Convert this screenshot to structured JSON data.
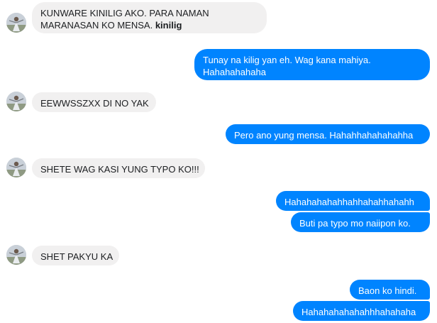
{
  "conversation": {
    "messages": [
      {
        "side": "in",
        "text": "KUNWARE KINILIG AKO. PARA NAMAN",
        "text2": "MARANASAN KO MENSA.",
        "bold": "kinilig"
      },
      {
        "side": "out",
        "text": "Tunay na kilig yan eh. Wag kana mahiya.",
        "text2": "Hahahahahaha"
      },
      {
        "side": "in",
        "text": "EEWWSSZXX DI NO YAK"
      },
      {
        "side": "out",
        "text": "Pero ano yung mensa. Hahahhahahahahha"
      },
      {
        "side": "in",
        "text": "SHETE WAG KASI YUNG TYPO KO!!!"
      },
      {
        "side": "out",
        "text": "Hahahahahahhahhahahhahahh"
      },
      {
        "side": "out",
        "text": "Buti pa typo mo naiipon ko."
      },
      {
        "side": "in",
        "text": "SHET PAKYU KA"
      },
      {
        "side": "out",
        "text": "Baon ko hindi."
      },
      {
        "side": "out",
        "text": "Hahahahahahahhhahahaha"
      }
    ]
  },
  "colors": {
    "outgoing_bubble": "#0084ff",
    "incoming_bubble": "#f1f0f0",
    "outgoing_text": "#ffffff",
    "incoming_text": "#1c1e21"
  },
  "icons": {
    "avatar": "contact-avatar-icon"
  }
}
